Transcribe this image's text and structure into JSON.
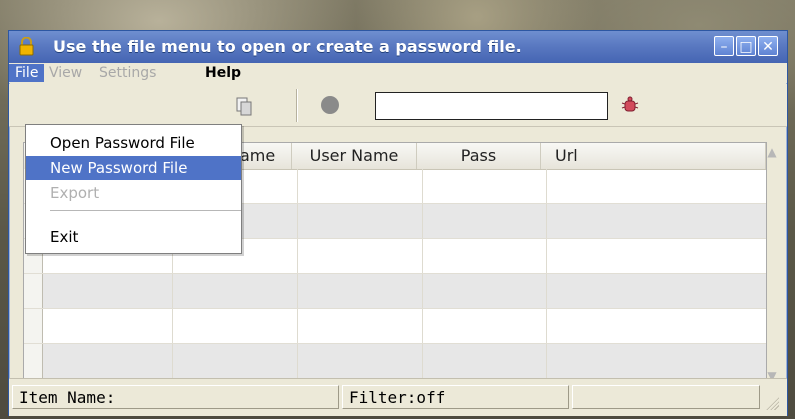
{
  "window": {
    "title": "Use the file menu to open or create a password file."
  },
  "menubar": {
    "items": [
      {
        "label": "File"
      },
      {
        "label": "View"
      },
      {
        "label": "Settings"
      },
      {
        "label": "Help"
      }
    ]
  },
  "file_menu": {
    "items": [
      {
        "label": "Open Password File"
      },
      {
        "label": "New Password File"
      },
      {
        "label": "Export"
      },
      {
        "label": "Exit"
      }
    ]
  },
  "table": {
    "headers": [
      "ame",
      "User Name",
      "Pass",
      "Url"
    ]
  },
  "status": {
    "item_name": "Item Name:",
    "filter": "Filter:off"
  },
  "icons": {
    "app": "lock-icon",
    "copy": "copy-icon",
    "record": "record-icon",
    "bug": "bug-icon"
  }
}
